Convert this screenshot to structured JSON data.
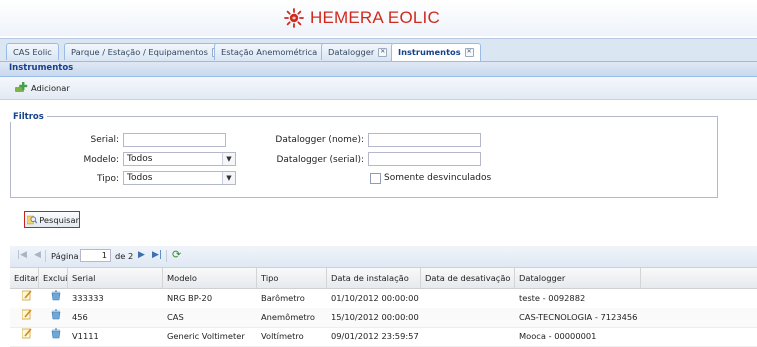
{
  "app": {
    "brand": "HEMERA EOLIC"
  },
  "tabs": [
    {
      "label": "CAS Eolic",
      "closable": false
    },
    {
      "label": "Parque / Estação / Equipamentos",
      "closable": true
    },
    {
      "label": "Estação Anemométrica",
      "closable": true
    },
    {
      "label": "Datalogger",
      "closable": true
    },
    {
      "label": "Instrumentos",
      "closable": true,
      "active": true
    }
  ],
  "panel": {
    "title": "Instrumentos"
  },
  "toolbar": {
    "add_label": "Adicionar"
  },
  "filters": {
    "legend": "Filtros",
    "serial_label": "Serial:",
    "serial_value": "",
    "modelo_label": "Modelo:",
    "modelo_value": "Todos",
    "tipo_label": "Tipo:",
    "tipo_value": "Todos",
    "datalogger_nome_label": "Datalogger (nome):",
    "datalogger_nome_value": "",
    "datalogger_serial_label": "Datalogger (serial):",
    "datalogger_serial_value": "",
    "somente_label": "Somente desvinculados",
    "somente_checked": false
  },
  "search": {
    "label": "Pesquisar"
  },
  "pager": {
    "page_label": "Página",
    "current_page": "1",
    "of_label": "de 2"
  },
  "grid": {
    "columns": [
      "Editar",
      "Excluir",
      "Serial",
      "Modelo",
      "Tipo",
      "Data de instalação",
      "Data de desativação",
      "Datalogger"
    ],
    "rows": [
      {
        "serial": "333333",
        "modelo": "NRG BP-20",
        "tipo": "Barômetro",
        "instalacao": "01/10/2012 00:00:00",
        "desativacao": "",
        "datalogger": "teste - 0092882"
      },
      {
        "serial": "456",
        "modelo": "CAS",
        "tipo": "Anemômetro",
        "instalacao": "15/10/2012 00:00:00",
        "desativacao": "",
        "datalogger": "CAS-TECNOLOGIA - 7123456"
      },
      {
        "serial": "V1111",
        "modelo": "Generic Voltimeter",
        "tipo": "Voltímetro",
        "instalacao": "09/01/2012 23:59:57",
        "desativacao": "",
        "datalogger": "Mooca - 00000001"
      }
    ]
  },
  "colors": {
    "brand": "#d12a1c",
    "panel_title": "#15428b",
    "search_border": "#c3231b"
  }
}
